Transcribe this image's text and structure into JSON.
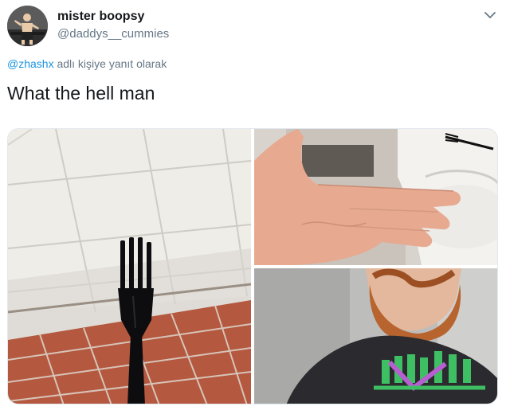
{
  "author": {
    "display_name": "mister boopsy",
    "handle": "@daddys__cummies",
    "avatar_icon": "user-avatar-icon"
  },
  "reply": {
    "mention": "@zhashx",
    "suffix": "adlı kişiye yanıt olarak"
  },
  "tweet": {
    "text": "What the hell man"
  },
  "media": {
    "count": 3,
    "photos": [
      {
        "icon": "fork-photo-icon"
      },
      {
        "icon": "hand-photo-icon"
      },
      {
        "icon": "selfie-photo-icon"
      }
    ]
  },
  "menu": {
    "icon": "chevron-down-icon"
  },
  "colors": {
    "text_primary": "#14171a",
    "text_secondary": "#657786",
    "link": "#1b95e0",
    "border": "#e1e8ed"
  }
}
